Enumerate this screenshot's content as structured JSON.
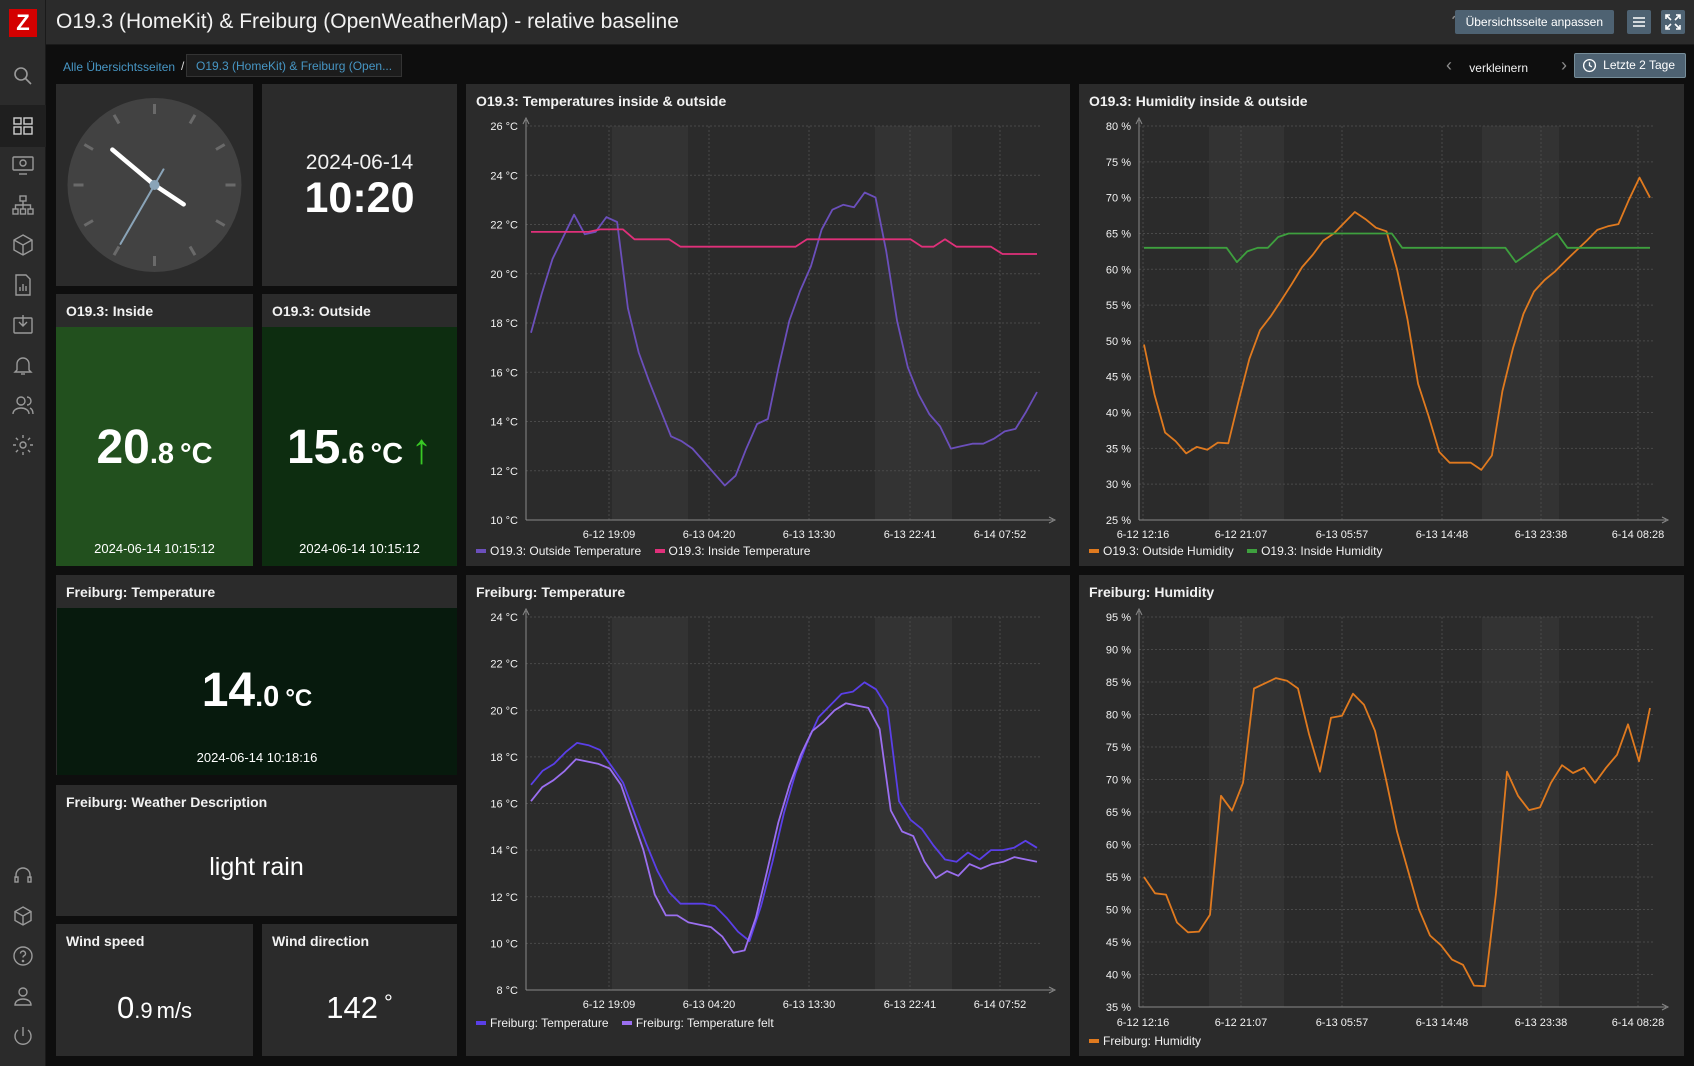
{
  "app": {
    "logo_letter": "Z"
  },
  "header": {
    "title": "O19.3 (HomeKit) & Freiburg (OpenWeatherMap) - relative baseline",
    "help": "?",
    "edit_button": "Übersichtsseite anpassen"
  },
  "breadcrumb": {
    "root": "Alle Übersichtsseiten",
    "separator": "/",
    "current": "O19.3 (HomeKit) & Freiburg (Open..."
  },
  "timeframe": {
    "zoom_out": "verkleinern",
    "range": "Letzte 2 Tage"
  },
  "sidebar": {
    "items": [
      "search-icon",
      "dashboard-icon",
      "monitoring-icon",
      "network-icon",
      "inventory-icon",
      "reports-icon",
      "data-collection-icon",
      "alerts-icon",
      "users-icon",
      "settings-icon"
    ],
    "bottom_items": [
      "support-icon",
      "integrations-icon",
      "help-icon",
      "user-settings-icon",
      "sign-out-icon"
    ]
  },
  "clock": {
    "hour": 10,
    "minute": 20,
    "second": 35
  },
  "datetime": {
    "date": "2024-06-14",
    "time": "10:20"
  },
  "inside": {
    "title": "O19.3: Inside",
    "int": "20",
    "dec": ".8",
    "unit": "°C",
    "timestamp": "2024-06-14 10:15:12",
    "color": "#22501e"
  },
  "outside": {
    "title": "O19.3: Outside",
    "int": "15",
    "dec": ".6",
    "unit": "°C",
    "arrow": "↑",
    "timestamp": "2024-06-14 10:15:12",
    "color": "#0d2d10"
  },
  "freiburg_temp": {
    "title": "Freiburg: Temperature",
    "int": "14",
    "dec": ".0",
    "unit": "°C",
    "timestamp": "2024-06-14 10:18:16",
    "color": "#071a0d"
  },
  "weather": {
    "title": "Freiburg: Weather Description",
    "value": "light rain"
  },
  "wind_speed": {
    "title": "Wind speed",
    "int": "0",
    "dec": ".9",
    "unit": "m/s"
  },
  "wind_dir": {
    "title": "Wind direction",
    "value": "142",
    "unit": "°"
  },
  "chart_data": [
    {
      "type": "line",
      "title": "O19.3: Temperatures inside & outside",
      "ylim": [
        10,
        26
      ],
      "y_ticks": [
        "26 °C",
        "24 °C",
        "22 °C",
        "20 °C",
        "18 °C",
        "16 °C",
        "14 °C",
        "12 °C",
        "10 °C"
      ],
      "x_ticks": [
        "6-12 19:09",
        "6-13 04:20",
        "6-13 13:30",
        "6-13 22:41",
        "6-14 07:52"
      ],
      "series": [
        {
          "name": "O19.3: Outside Temperature",
          "color": "#6b4fbb",
          "values": [
            17.6,
            19.2,
            20.6,
            21.5,
            22.4,
            21.6,
            21.7,
            22.3,
            22.1,
            18.6,
            16.8,
            15.6,
            14.5,
            13.4,
            13.2,
            12.9,
            12.4,
            11.9,
            11.4,
            11.8,
            12.9,
            13.9,
            14.1,
            16.2,
            18.1,
            19.3,
            20.3,
            21.8,
            22.6,
            22.8,
            22.7,
            23.3,
            23.1,
            20.9,
            18.1,
            16.2,
            15.1,
            14.3,
            13.8,
            12.9,
            13.0,
            13.1,
            13.1,
            13.3,
            13.6,
            13.7,
            14.4,
            15.2
          ]
        },
        {
          "name": "O19.3: Inside Temperature",
          "color": "#e0307a",
          "values": [
            21.7,
            21.7,
            21.7,
            21.7,
            21.7,
            21.7,
            21.8,
            21.8,
            21.8,
            21.4,
            21.4,
            21.4,
            21.4,
            21.1,
            21.1,
            21.1,
            21.1,
            21.1,
            21.1,
            21.1,
            21.1,
            21.1,
            21.1,
            21.1,
            21.4,
            21.4,
            21.4,
            21.4,
            21.4,
            21.4,
            21.4,
            21.4,
            21.4,
            21.4,
            21.1,
            21.1,
            21.4,
            21.1,
            21.1,
            21.1,
            21.1,
            20.8,
            20.8,
            20.8,
            20.8
          ]
        }
      ]
    },
    {
      "type": "line",
      "title": "O19.3: Humidity inside & outside",
      "ylim": [
        25,
        80
      ],
      "y_ticks": [
        "80 %",
        "75 %",
        "70 %",
        "65 %",
        "60 %",
        "55 %",
        "50 %",
        "45 %",
        "40 %",
        "35 %",
        "30 %",
        "25 %"
      ],
      "x_ticks": [
        "6-12 12:16",
        "6-12 21:07",
        "6-13 05:57",
        "6-13 14:48",
        "6-13 23:38",
        "6-14 08:28"
      ],
      "series": [
        {
          "name": "O19.3: Outside Humidity",
          "color": "#e07a1f",
          "values": [
            49.5,
            42.5,
            37.2,
            36,
            34.3,
            35.2,
            34.8,
            35.8,
            35.7,
            41.8,
            47.5,
            51.5,
            53.4,
            55.6,
            57.9,
            60.3,
            62,
            64,
            65,
            66.5,
            68,
            67,
            65.8,
            65.3,
            60,
            53,
            44,
            39.5,
            34.5,
            33,
            33,
            33,
            32,
            34,
            43,
            49,
            53.8,
            56.9,
            58.5,
            59.7,
            61.2,
            62.6,
            64,
            65.5,
            66,
            66.3,
            69.7,
            72.8,
            70
          ]
        },
        {
          "name": "O19.3: Inside Humidity",
          "color": "#3ea03e",
          "values": [
            63,
            63,
            63,
            63,
            63,
            63,
            63,
            63,
            63,
            61,
            62.5,
            63,
            63,
            64.5,
            65,
            65,
            65,
            65,
            65,
            65,
            65,
            65,
            65,
            65,
            65,
            63,
            63,
            63,
            63,
            63,
            63,
            63,
            63,
            63,
            63,
            63,
            61,
            62,
            63,
            64,
            65,
            63,
            63,
            63,
            63,
            63,
            63,
            63,
            63,
            63
          ]
        }
      ]
    },
    {
      "type": "line",
      "title": "Freiburg: Temperature",
      "ylim": [
        8,
        24
      ],
      "y_ticks": [
        "24 °C",
        "22 °C",
        "20 °C",
        "18 °C",
        "16 °C",
        "14 °C",
        "12 °C",
        "10 °C",
        "8 °C"
      ],
      "x_ticks": [
        "6-12 19:09",
        "6-13 04:20",
        "6-13 13:30",
        "6-13 22:41",
        "6-14 07:52"
      ],
      "series": [
        {
          "name": "Freiburg: Temperature",
          "color": "#5a3fe8",
          "values": [
            16.8,
            17.4,
            17.7,
            18.2,
            18.6,
            18.5,
            18.3,
            17.6,
            16.9,
            15.6,
            14.3,
            13.1,
            12.2,
            11.7,
            11.7,
            11.7,
            11.6,
            11.1,
            10.5,
            10.1,
            11.6,
            13.5,
            15.6,
            17.3,
            18.6,
            19.7,
            20.2,
            20.7,
            20.8,
            21.2,
            20.9,
            20.1,
            16.1,
            15.3,
            14.9,
            14.2,
            13.6,
            13.5,
            13.9,
            13.6,
            14,
            14,
            14.1,
            14.4,
            14.1
          ]
        },
        {
          "name": "Freiburg: Temperature felt",
          "color": "#9b6ff0",
          "values": [
            16.1,
            16.7,
            17,
            17.4,
            17.9,
            17.8,
            17.7,
            17.5,
            16.8,
            15.4,
            14,
            12.1,
            11.2,
            11.2,
            10.9,
            10.8,
            10.7,
            10.3,
            9.6,
            9.7,
            11.1,
            13.1,
            15.2,
            16.8,
            18.1,
            19.1,
            19.5,
            20,
            20.3,
            20.2,
            20.1,
            19.2,
            15.7,
            14.8,
            14.6,
            13.5,
            12.8,
            13.1,
            12.9,
            13.4,
            13.2,
            13.4,
            13.5,
            13.7,
            13.6,
            13.5
          ]
        }
      ]
    },
    {
      "type": "line",
      "title": "Freiburg: Humidity",
      "ylim": [
        35,
        95
      ],
      "y_ticks": [
        "95 %",
        "90 %",
        "85 %",
        "80 %",
        "75 %",
        "70 %",
        "65 %",
        "60 %",
        "55 %",
        "50 %",
        "45 %",
        "40 %",
        "35 %"
      ],
      "x_ticks": [
        "6-12 12:16",
        "6-12 21:07",
        "6-13 05:57",
        "6-13 14:48",
        "6-13 23:38",
        "6-14 08:28"
      ],
      "series": [
        {
          "name": "Freiburg: Humidity",
          "color": "#e07a1f",
          "values": [
            55,
            52.5,
            52.3,
            48,
            46.5,
            46.6,
            49.2,
            67.5,
            65.2,
            69.5,
            84,
            84.8,
            85.6,
            85.2,
            84,
            77,
            71.2,
            79.5,
            79.8,
            83.2,
            81.5,
            77.5,
            70,
            62,
            56,
            50,
            46,
            44.5,
            42.3,
            41.5,
            38.3,
            38.2,
            52.5,
            71.2,
            67.5,
            65.3,
            65.7,
            69.5,
            72.2,
            71,
            71.8,
            69.5,
            71.8,
            73.8,
            78.5,
            72.8,
            81
          ]
        }
      ]
    }
  ]
}
